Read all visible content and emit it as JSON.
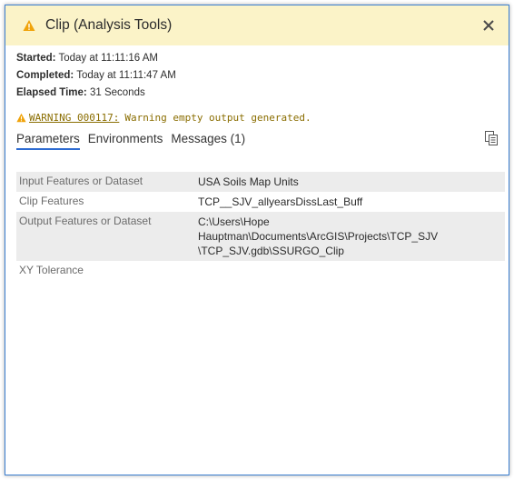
{
  "dialog": {
    "title": "Clip (Analysis Tools)",
    "title_icon": "warning-icon",
    "close_icon": "close-icon",
    "colors": {
      "title_bg": "#fbf3c8",
      "warning_text": "#8a6d00",
      "accent": "#2d6bd1",
      "border": "#3b7fd1"
    }
  },
  "meta": {
    "started_label": "Started:",
    "started_value": "Today at 11:11:16 AM",
    "completed_label": "Completed:",
    "completed_value": "Today at 11:11:47 AM",
    "elapsed_label": "Elapsed Time:",
    "elapsed_value": "31 Seconds"
  },
  "warning": {
    "code": "WARNING 000117:",
    "message": "Warning empty output generated."
  },
  "tabs": [
    {
      "label": "Parameters",
      "active": true
    },
    {
      "label": "Environments",
      "active": false
    },
    {
      "label": "Messages (1)",
      "active": false
    }
  ],
  "copy_icon": "copy-icon",
  "parameters": [
    {
      "name": "Input Features or Dataset",
      "value": "USA Soils Map Units"
    },
    {
      "name": "Clip Features",
      "value": "TCP__SJV_allyearsDissLast_Buff"
    },
    {
      "name": "Output Features or Dataset",
      "value": "C:\\Users\\Hope Hauptman\\Documents\\ArcGIS\\Projects\\TCP_SJV",
      "value_line2": "\\TCP_SJV.gdb\\SSURGO_Clip"
    },
    {
      "name": "XY Tolerance",
      "value": ""
    }
  ]
}
